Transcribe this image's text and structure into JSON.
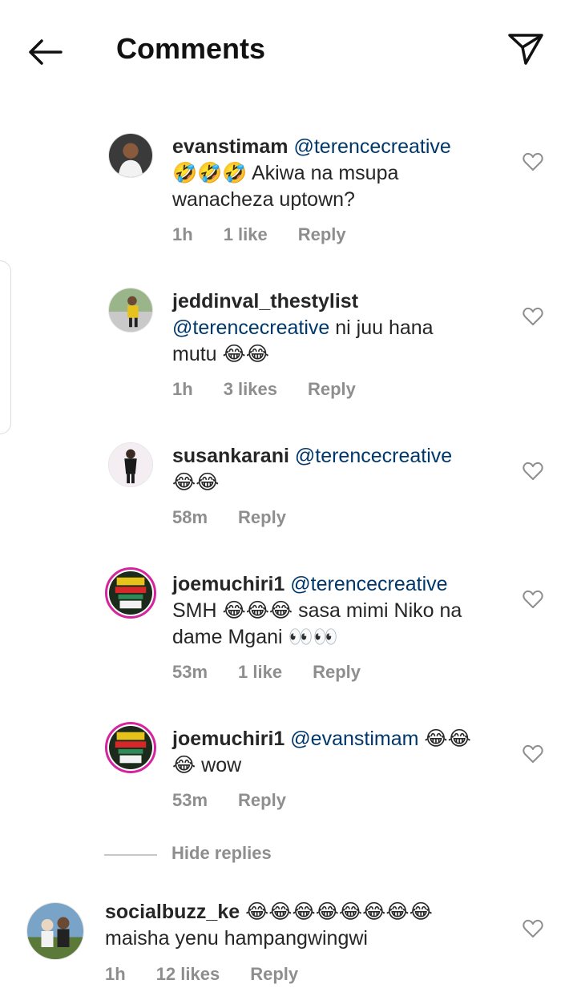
{
  "header": {
    "title": "Comments",
    "back_icon": "arrow-left-icon",
    "send_icon": "paper-plane-icon"
  },
  "comments": [
    {
      "username": "evanstimam",
      "mention": "@terencecreative",
      "line1_emoji": "🤣🤣🤣",
      "line1_text": " Akiwa na msupa",
      "line2_text": "wanacheza uptown?",
      "time": "1h",
      "likes": "1 like",
      "reply": "Reply"
    },
    {
      "username": "jeddinval_thestylist",
      "mention": "@terencecreative",
      "line2_text": " ni juu hana",
      "line3_text": "mutu ",
      "line3_emoji": "😂😂",
      "time": "1h",
      "likes": "3 likes",
      "reply": "Reply"
    },
    {
      "username": "susankarani",
      "mention": "@terencecreative",
      "line2_emoji": "😂😂",
      "time": "58m",
      "reply": "Reply"
    },
    {
      "username": "joemuchiri1",
      "mention": "@terencecreative",
      "line2_text_a": "SMH ",
      "line2_emoji": "😂😂😂",
      "line2_text_b": " sasa mimi Niko na",
      "line3_text": "dame Mgani ",
      "line3_emoji": "👀👀",
      "time": "53m",
      "likes": "1 like",
      "reply": "Reply"
    },
    {
      "username": "joemuchiri1",
      "mention": "@evanstimam",
      "line1_emoji": " 😂😂",
      "line2_emoji": "😂",
      "line2_text": " wow",
      "time": "53m",
      "reply": "Reply"
    },
    {
      "username": "socialbuzz_ke",
      "line1_emoji": " 😂😂😂😂😂😂😂😂",
      "line2_text": "maisha yenu hampangwingwi",
      "time": "1h",
      "likes": "12 likes",
      "reply": "Reply"
    }
  ],
  "hide_replies": "Hide replies",
  "colors": {
    "mention": "#00376b",
    "meta": "#8e8e8e",
    "story_ring": "#d6249f"
  }
}
